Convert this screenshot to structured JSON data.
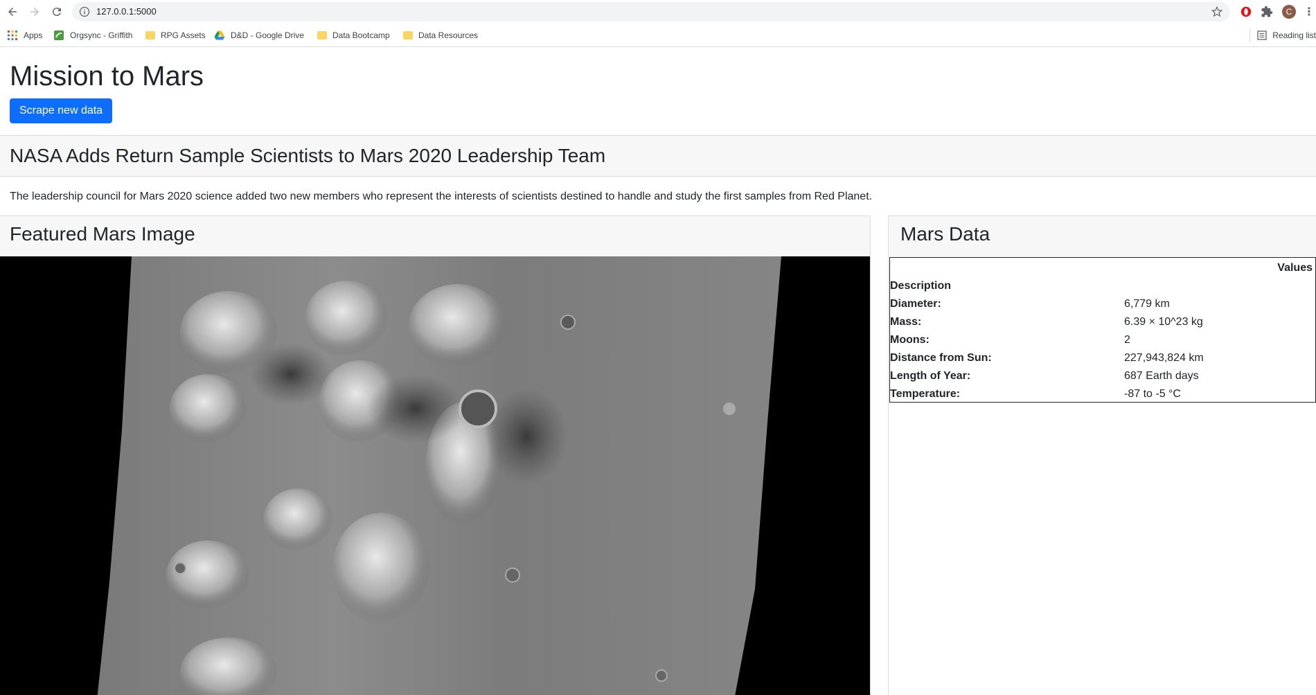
{
  "browser": {
    "url": "127.0.0.1:5000",
    "bookmarks": [
      {
        "label": "Apps",
        "icon": "apps-grid-icon"
      },
      {
        "label": "Orgsync - Griffith",
        "icon": "orgsync-icon"
      },
      {
        "label": "RPG Assets",
        "icon": "folder-icon"
      },
      {
        "label": "D&D - Google Drive",
        "icon": "google-drive-icon"
      },
      {
        "label": "Data Bootcamp",
        "icon": "folder-icon"
      },
      {
        "label": "Data Resources",
        "icon": "folder-icon"
      }
    ],
    "reading_list": "Reading list",
    "profile_initial": "C"
  },
  "page": {
    "title": "Mission to Mars",
    "scrape_button": "Scrape new data",
    "news_title": "NASA Adds Return Sample Scientists to Mars 2020 Leadership Team",
    "news_paragraph": "The leadership council for Mars 2020 science added two new members who represent the interests of scientists destined to handle and study the first samples from Red Planet.",
    "featured_image_heading": "Featured Mars Image",
    "mars_data_heading": "Mars Data",
    "table": {
      "values_header": "Values",
      "description_header": "Description",
      "rows": [
        {
          "label": "Diameter:",
          "value": "6,779 km"
        },
        {
          "label": "Mass:",
          "value": "6.39 × 10^23 kg"
        },
        {
          "label": "Moons:",
          "value": "2"
        },
        {
          "label": "Distance from Sun:",
          "value": "227,943,824 km"
        },
        {
          "label": "Length of Year:",
          "value": "687 Earth days"
        },
        {
          "label": "Temperature:",
          "value": "-87 to -5 °C"
        }
      ]
    }
  },
  "colors": {
    "primary": "#0d6efd",
    "header_bg": "#f7f7f7",
    "text": "#212529"
  }
}
